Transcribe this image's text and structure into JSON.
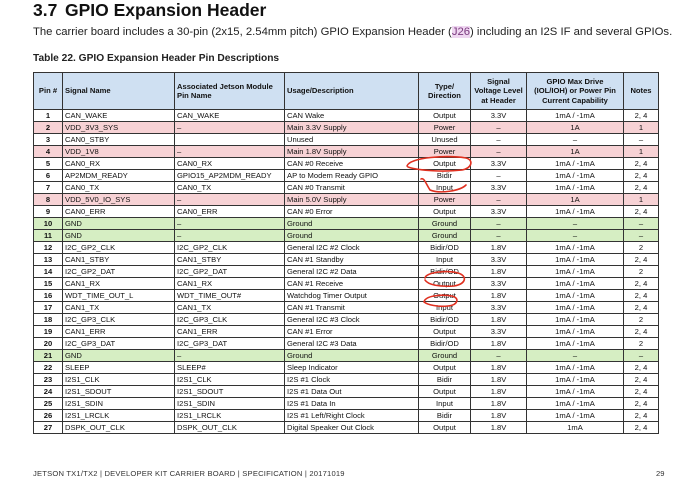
{
  "section": {
    "number": "3.7",
    "title": "GPIO Expansion Header"
  },
  "intro": {
    "before": "The carrier board includes a 30-pin (2x15, 2.54mm pitch) GPIO Expansion Header (",
    "highlight": "J26",
    "after": ") including an I2S IF and several GPIOs."
  },
  "table": {
    "caption": "Table 22.  GPIO Expansion Header Pin Descriptions",
    "headers": {
      "pin": "Pin #",
      "signal": "Signal Name",
      "module_pin": "Associated Jetson Module Pin Name",
      "usage": "Usage/Description",
      "type": "Type/ Direction",
      "voltage": "Signal Voltage Level at Header",
      "drive": "GPIO Max Drive (IOL/IOH) or Power Pin Current Capability",
      "notes": "Notes"
    },
    "rows": [
      {
        "pin": "1",
        "signal": "CAN_WAKE",
        "module": "CAN_WAKE",
        "usage": "CAN Wake",
        "type": "Output",
        "voltage": "3.3V",
        "drive": "1mA / -1mA",
        "notes": "2, 4",
        "style": "plain"
      },
      {
        "pin": "2",
        "signal": "VDD_3V3_SYS",
        "module": "–",
        "usage": "Main 3.3V Supply",
        "type": "Power",
        "voltage": "–",
        "drive": "1A",
        "notes": "1",
        "style": "pink"
      },
      {
        "pin": "3",
        "signal": "CAN0_STBY",
        "module": "",
        "usage": "Unused",
        "type": "Unused",
        "voltage": "–",
        "drive": "–",
        "notes": "–",
        "style": "plain"
      },
      {
        "pin": "4",
        "signal": "VDD_1V8",
        "module": "–",
        "usage": "Main 1.8V Supply",
        "type": "Power",
        "voltage": "–",
        "drive": "1A",
        "notes": "1",
        "style": "pink"
      },
      {
        "pin": "5",
        "signal": "CAN0_RX",
        "module": "CAN0_RX",
        "usage": "CAN #0 Receive",
        "type": "Output",
        "voltage": "3.3V",
        "drive": "1mA / -1mA",
        "notes": "2, 4",
        "style": "plain"
      },
      {
        "pin": "6",
        "signal": "AP2MDM_READY",
        "module": "GPIO15_AP2MDM_READY",
        "usage": "AP to Modem Ready GPIO",
        "type": "Bidir",
        "voltage": "–",
        "drive": "1mA / -1mA",
        "notes": "2, 4",
        "style": "plain"
      },
      {
        "pin": "7",
        "signal": "CAN0_TX",
        "module": "CAN0_TX",
        "usage": "CAN #0 Transmit",
        "type": "Input",
        "voltage": "3.3V",
        "drive": "1mA / -1mA",
        "notes": "2, 4",
        "style": "plain"
      },
      {
        "pin": "8",
        "signal": "VDD_5V0_IO_SYS",
        "module": "–",
        "usage": "Main 5.0V Supply",
        "type": "Power",
        "voltage": "–",
        "drive": "1A",
        "notes": "1",
        "style": "pink"
      },
      {
        "pin": "9",
        "signal": "CAN0_ERR",
        "module": "CAN0_ERR",
        "usage": "CAN #0 Error",
        "type": "Output",
        "voltage": "3.3V",
        "drive": "1mA / -1mA",
        "notes": "2, 4",
        "style": "plain"
      },
      {
        "pin": "10",
        "signal": "GND",
        "module": "–",
        "usage": "Ground",
        "type": "Ground",
        "voltage": "–",
        "drive": "–",
        "notes": "–",
        "style": "green"
      },
      {
        "pin": "11",
        "signal": "GND",
        "module": "–",
        "usage": "Ground",
        "type": "Ground",
        "voltage": "–",
        "drive": "–",
        "notes": "–",
        "style": "green"
      },
      {
        "pin": "12",
        "signal": "I2C_GP2_CLK",
        "module": "I2C_GP2_CLK",
        "usage": "General I2C #2 Clock",
        "type": "Bidir/OD",
        "voltage": "1.8V",
        "drive": "1mA / -1mA",
        "notes": "2",
        "style": "plain"
      },
      {
        "pin": "13",
        "signal": "CAN1_STBY",
        "module": "CAN1_STBY",
        "usage": "CAN #1 Standby",
        "type": "Input",
        "voltage": "3.3V",
        "drive": "1mA / -1mA",
        "notes": "2, 4",
        "style": "plain"
      },
      {
        "pin": "14",
        "signal": "I2C_GP2_DAT",
        "module": "I2C_GP2_DAT",
        "usage": "General I2C #2 Data",
        "type": "Bidir/OD",
        "voltage": "1.8V",
        "drive": "1mA / -1mA",
        "notes": "2",
        "style": "plain"
      },
      {
        "pin": "15",
        "signal": "CAN1_RX",
        "module": "CAN1_RX",
        "usage": "CAN #1 Receive",
        "type": "Output",
        "voltage": "3.3V",
        "drive": "1mA / -1mA",
        "notes": "2, 4",
        "style": "plain"
      },
      {
        "pin": "16",
        "signal": "WDT_TIME_OUT_L",
        "module": "WDT_TIME_OUT#",
        "usage": "Watchdog Timer Output",
        "type": "Output",
        "voltage": "1.8V",
        "drive": "1mA / -1mA",
        "notes": "2, 4",
        "style": "plain"
      },
      {
        "pin": "17",
        "signal": "CAN1_TX",
        "module": "CAN1_TX",
        "usage": "CAN #1 Transmit",
        "type": "Input",
        "voltage": "3.3V",
        "drive": "1mA / -1mA",
        "notes": "2, 4",
        "style": "plain"
      },
      {
        "pin": "18",
        "signal": "I2C_GP3_CLK",
        "module": "I2C_GP3_CLK",
        "usage": "General I2C #3 Clock",
        "type": "Bidir/OD",
        "voltage": "1.8V",
        "drive": "1mA / -1mA",
        "notes": "2",
        "style": "plain"
      },
      {
        "pin": "19",
        "signal": "CAN1_ERR",
        "module": "CAN1_ERR",
        "usage": "CAN #1 Error",
        "type": "Output",
        "voltage": "3.3V",
        "drive": "1mA / -1mA",
        "notes": "2, 4",
        "style": "plain"
      },
      {
        "pin": "20",
        "signal": "I2C_GP3_DAT",
        "module": "I2C_GP3_DAT",
        "usage": "General I2C #3 Data",
        "type": "Bidir/OD",
        "voltage": "1.8V",
        "drive": "1mA / -1mA",
        "notes": "2",
        "style": "plain"
      },
      {
        "pin": "21",
        "signal": "GND",
        "module": "–",
        "usage": "Ground",
        "type": "Ground",
        "voltage": "–",
        "drive": "–",
        "notes": "–",
        "style": "green"
      },
      {
        "pin": "22",
        "signal": "SLEEP",
        "module": "SLEEP#",
        "usage": "Sleep Indicator",
        "type": "Output",
        "voltage": "1.8V",
        "drive": "1mA / -1mA",
        "notes": "2, 4",
        "style": "plain"
      },
      {
        "pin": "23",
        "signal": "I2S1_CLK",
        "module": "I2S1_CLK",
        "usage": "I2S #1 Clock",
        "type": "Bidir",
        "voltage": "1.8V",
        "drive": "1mA / -1mA",
        "notes": "2, 4",
        "style": "plain"
      },
      {
        "pin": "24",
        "signal": "I2S1_SDOUT",
        "module": "I2S1_SDOUT",
        "usage": "I2S #1 Data Out",
        "type": "Output",
        "voltage": "1.8V",
        "drive": "1mA / -1mA",
        "notes": "2, 4",
        "style": "plain"
      },
      {
        "pin": "25",
        "signal": "I2S1_SDIN",
        "module": "I2S1_SDIN",
        "usage": "I2S #1 Data In",
        "type": "Input",
        "voltage": "1.8V",
        "drive": "1mA / -1mA",
        "notes": "2, 4",
        "style": "plain"
      },
      {
        "pin": "26",
        "signal": "I2S1_LRCLK",
        "module": "I2S1_LRCLK",
        "usage": "I2S #1 Left/Right Clock",
        "type": "Bidir",
        "voltage": "1.8V",
        "drive": "1mA / -1mA",
        "notes": "2, 4",
        "style": "plain"
      },
      {
        "pin": "27",
        "signal": "DSPK_OUT_CLK",
        "module": "DSPK_OUT_CLK",
        "usage": "Digital Speaker Out Clock",
        "type": "Output",
        "voltage": "1.8V",
        "drive": "1mA",
        "notes": "2, 4",
        "style": "plain"
      }
    ]
  },
  "footer": {
    "text": "JETSON TX1/TX2 | DEVELOPER KIT CARRIER BOARD | SPECIFICATION | 20171019",
    "page": "29"
  },
  "colors": {
    "header_bg": "#cfe0f2",
    "power_row": "#f7d2d5",
    "ground_row": "#d6eec3",
    "annotation": "#e03020",
    "highlight": "#efd6f1"
  }
}
